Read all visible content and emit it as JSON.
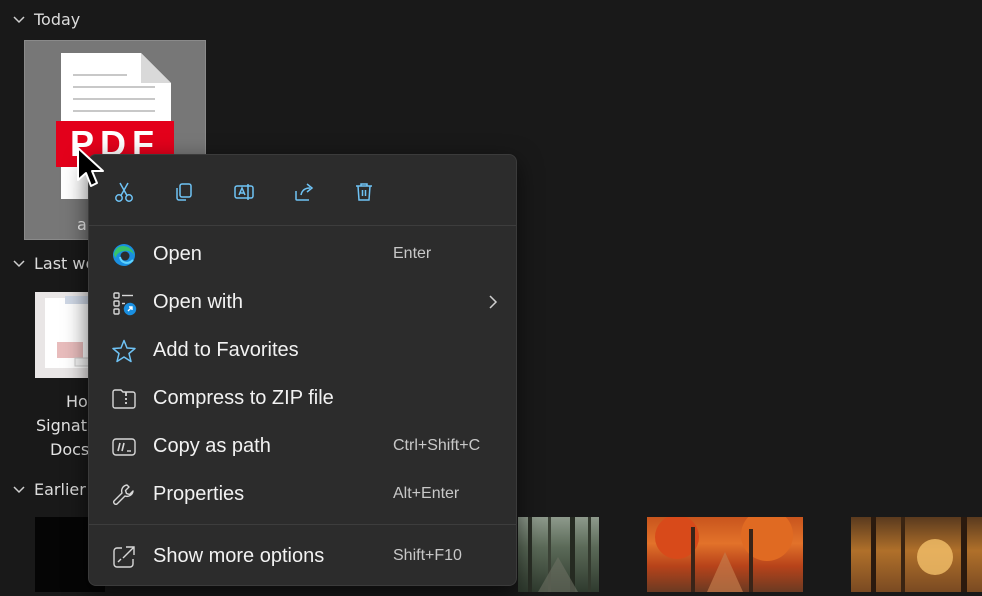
{
  "groups": {
    "today": "Today",
    "last_week": "Last we",
    "earlier": "Earlier"
  },
  "files": {
    "pdf_badge": "PDF",
    "pdf_name": "a",
    "doc_caption_lines": [
      "Ho",
      "Signat",
      "Docs"
    ]
  },
  "menu": {
    "toolbar": [
      {
        "name": "cut-icon"
      },
      {
        "name": "copy-icon"
      },
      {
        "name": "rename-icon"
      },
      {
        "name": "share-icon"
      },
      {
        "name": "delete-icon"
      }
    ],
    "items": [
      {
        "label": "Open",
        "shortcut": "Enter",
        "icon": "edge-icon"
      },
      {
        "label": "Open with",
        "shortcut": "",
        "icon": "open-with-icon",
        "submenu": true
      },
      {
        "label": "Add to Favorites",
        "shortcut": "",
        "icon": "star-icon"
      },
      {
        "label": "Compress to ZIP file",
        "shortcut": "",
        "icon": "zip-folder-icon"
      },
      {
        "label": "Copy as path",
        "shortcut": "Ctrl+Shift+C",
        "icon": "copy-path-icon"
      },
      {
        "label": "Properties",
        "shortcut": "Alt+Enter",
        "icon": "wrench-icon"
      },
      {
        "label": "Show more options",
        "shortcut": "Shift+F10",
        "icon": "more-options-icon"
      }
    ]
  },
  "colors": {
    "accent": "#4cc2ff",
    "pdf_red": "#e3001b",
    "menu_bg": "#2c2c2c",
    "window_bg": "#191919"
  }
}
